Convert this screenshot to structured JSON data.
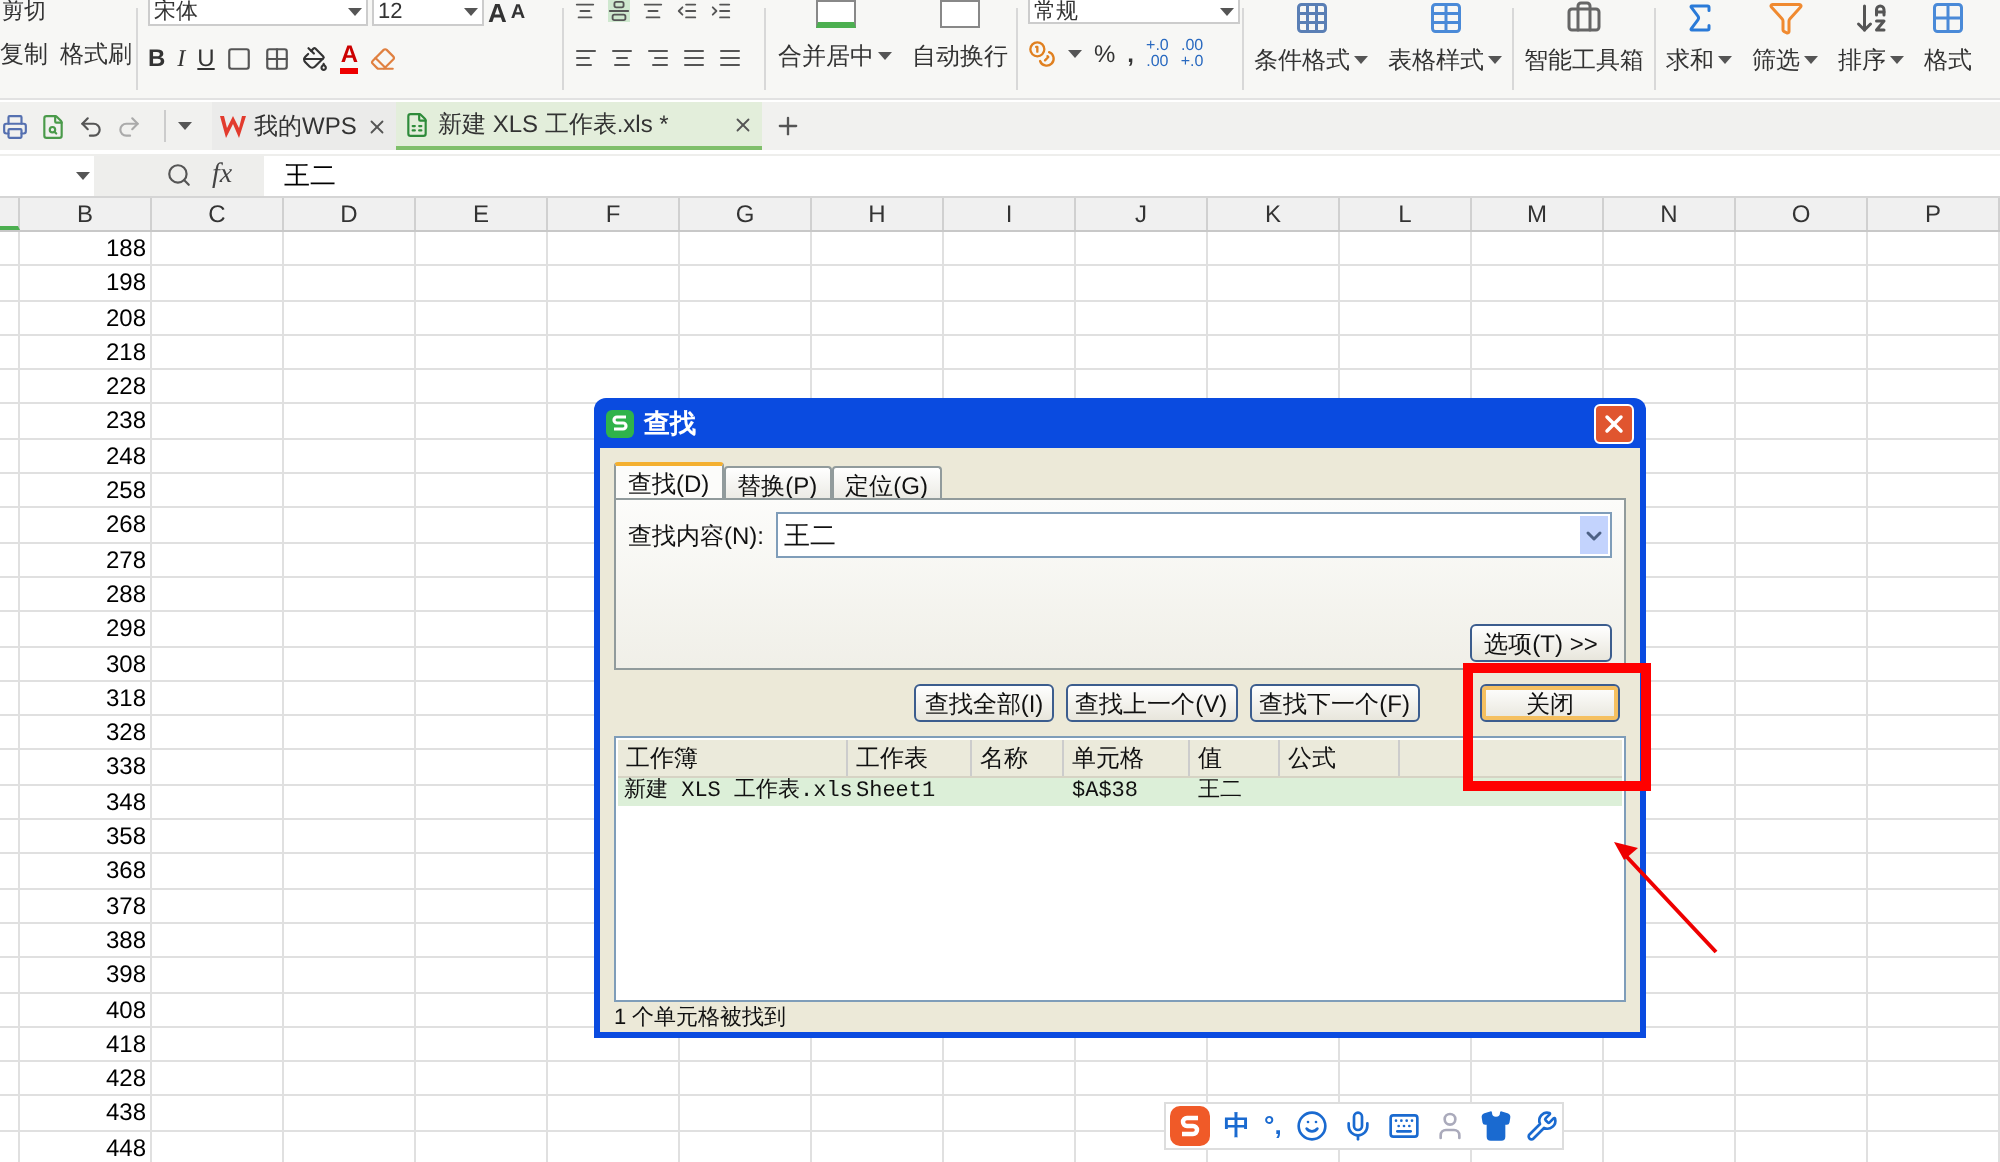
{
  "ribbon": {
    "clipboard": {
      "cut": "剪切",
      "copy": "复制",
      "format_painter": "格式刷"
    },
    "font": {
      "name": "宋体",
      "size": "12",
      "bold": "B",
      "italic": "I",
      "underline": "U",
      "grow": "A",
      "shrink": "A",
      "font_color": "A"
    },
    "merge": "合并居中",
    "wrap": "自动换行",
    "number": {
      "format": "常规",
      "percent": "%",
      "comma": ",",
      "increase_decimal": [
        "+.0",
        ".00"
      ],
      "decrease_decimal": [
        ".00",
        "+.0"
      ]
    },
    "tools": [
      {
        "label": "条件格式",
        "kind": "conditional",
        "dropdown": true
      },
      {
        "label": "表格样式",
        "kind": "table-style",
        "dropdown": true
      },
      {
        "label": "智能工具箱",
        "kind": "toolbox",
        "dropdown": false
      },
      {
        "label": "求和",
        "kind": "sum",
        "dropdown": true
      },
      {
        "label": "筛选",
        "kind": "filter",
        "dropdown": true
      },
      {
        "label": "排序",
        "kind": "sort",
        "dropdown": true
      },
      {
        "label": "格式",
        "kind": "format",
        "dropdown": false
      }
    ]
  },
  "doc_tabs": [
    {
      "label": "我的WPS",
      "kind": "wps",
      "selected": false
    },
    {
      "label": "新建 XLS 工作表.xls *",
      "kind": "sheet",
      "selected": true
    }
  ],
  "formula_bar": {
    "fx": "fx",
    "value": "王二"
  },
  "sheet": {
    "columns": [
      "B",
      "C",
      "D",
      "E",
      "F",
      "G",
      "H",
      "I",
      "J",
      "K",
      "L",
      "M",
      "N",
      "O",
      "P"
    ],
    "rows": [
      "188",
      "198",
      "208",
      "218",
      "228",
      "238",
      "248",
      "258",
      "268",
      "278",
      "288",
      "298",
      "308",
      "318",
      "328",
      "338",
      "348",
      "358",
      "368",
      "378",
      "388",
      "398",
      "408",
      "418",
      "428",
      "438",
      "448"
    ]
  },
  "dialog": {
    "title": "查找",
    "tabs": [
      {
        "label": "查找(D)",
        "selected": true
      },
      {
        "label": "替换(P)",
        "selected": false
      },
      {
        "label": "定位(G)",
        "selected": false
      }
    ],
    "find_label": "查找内容(N):",
    "find_value": "王二",
    "options_button": "选项(T) >>",
    "buttons": [
      {
        "label": "查找全部(I)",
        "focused": false
      },
      {
        "label": "查找上一个(V)",
        "focused": false
      },
      {
        "label": "查找下一个(F)",
        "focused": false
      }
    ],
    "close_button": {
      "label": "关闭",
      "focused": true
    },
    "results": {
      "columns": [
        "工作簿",
        "工作表",
        "名称",
        "单元格",
        "值",
        "公式"
      ],
      "rows": [
        {
          "workbook": "新建 XLS 工作表.xls",
          "sheet": "Sheet1",
          "cell": "$A$38",
          "value": "王二",
          "selected": true
        }
      ]
    },
    "status": "1 个单元格被找到"
  },
  "ime_bar": {
    "mode": "中",
    "punctuation": "°,"
  }
}
